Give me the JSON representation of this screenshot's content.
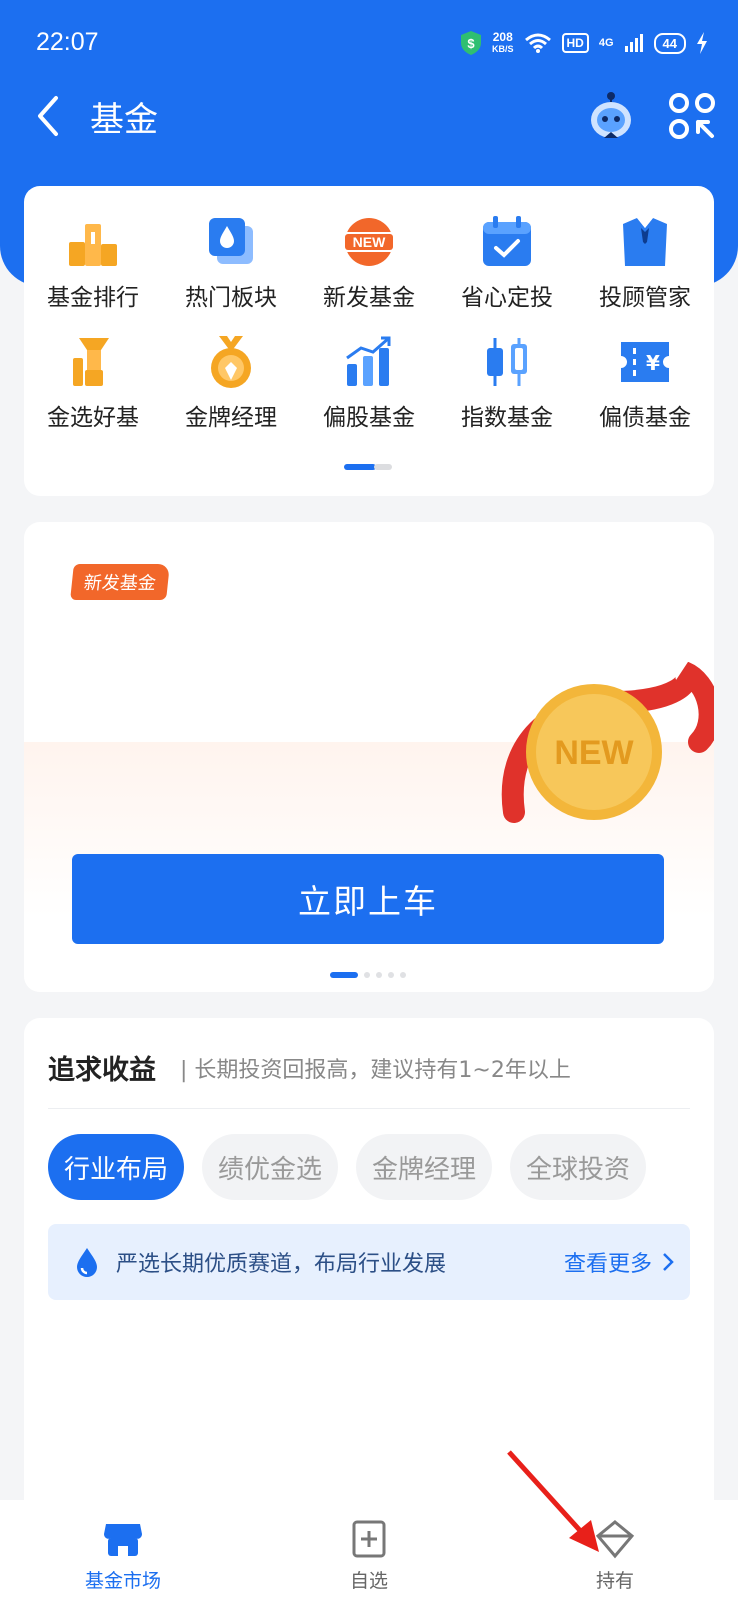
{
  "status_bar": {
    "time": "22:07",
    "speed_value": "208",
    "speed_unit": "KB/S",
    "hd": "HD",
    "network": "4G",
    "battery": "44"
  },
  "nav": {
    "title": "基金",
    "back_icon": "chevron-left-icon",
    "assistant_icon": "robot-icon",
    "scan_icon": "scan-icon"
  },
  "grid": {
    "items": [
      {
        "label": "基金排行",
        "icon": "podium-icon",
        "color": "#f5a623"
      },
      {
        "label": "热门板块",
        "icon": "drop-cards-icon",
        "color": "#2a7cf0"
      },
      {
        "label": "新发基金",
        "icon": "new-badge-icon",
        "color": "#f2672a"
      },
      {
        "label": "省心定投",
        "icon": "calendar-check-icon",
        "color": "#2a7cf0"
      },
      {
        "label": "投顾管家",
        "icon": "suit-icon",
        "color": "#2a7cf0"
      },
      {
        "label": "金选好基",
        "icon": "trophy-icon",
        "color": "#f5a623"
      },
      {
        "label": "金牌经理",
        "icon": "medal-icon",
        "color": "#f5a623"
      },
      {
        "label": "偏股基金",
        "icon": "bar-chart-icon",
        "color": "#2a7cf0"
      },
      {
        "label": "指数基金",
        "icon": "candlestick-icon",
        "color": "#2a7cf0"
      },
      {
        "label": "偏债基金",
        "icon": "yen-ticket-icon",
        "color": "#2a7cf0"
      }
    ]
  },
  "banner": {
    "badge": "新发基金",
    "medal_text": "NEW",
    "cta": "立即上车"
  },
  "returns": {
    "title": "追求收益",
    "subtitle": "| 长期投资回报高，建议持有1~2年以上",
    "chips": [
      "行业布局",
      "绩优金选",
      "金牌经理",
      "全球投资"
    ],
    "active_chip": "行业布局",
    "info_text": "严选长期优质赛道，布局行业发展",
    "more": "查看更多"
  },
  "tabs": [
    {
      "label": "基金市场",
      "icon": "store-icon",
      "active": true
    },
    {
      "label": "自选",
      "icon": "add-bookmark-icon",
      "active": false
    },
    {
      "label": "持有",
      "icon": "diamond-icon",
      "active": false
    }
  ],
  "colors": {
    "primary": "#1c6ff0",
    "orange": "#f2672a",
    "gold": "#f5a623"
  }
}
